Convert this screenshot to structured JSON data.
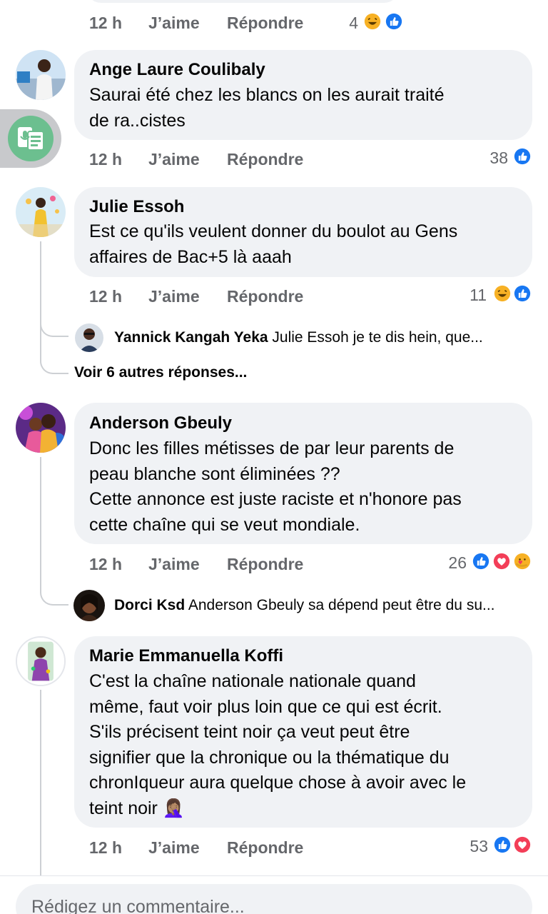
{
  "comments": [
    {
      "time": "12 h",
      "like": "J’aime",
      "reply": "Répondre",
      "count": "4",
      "reactions": [
        "haha-reaction",
        "like-reaction"
      ]
    },
    {
      "author": "Ange Laure Coulibaly",
      "lines": [
        "Saurai été chez les blancs on les aurait traité",
        "de ra..cistes"
      ],
      "time": "12 h",
      "like": "J’aime",
      "reply": "Répondre",
      "count": "38",
      "reactions": [
        "like-reaction"
      ]
    },
    {
      "author": "Julie Essoh",
      "lines": [
        "Est ce qu'ils veulent donner du boulot au Gens",
        "affaires de Bac+5 là aaah"
      ],
      "time": "12 h",
      "like": "J’aime",
      "reply": "Répondre",
      "count": "11",
      "reactions": [
        "haha-reaction",
        "like-reaction"
      ],
      "reply_preview": {
        "name": "Yannick Kangah Yeka",
        "text": "Julie Essoh je te dis hein,   que..."
      },
      "more_replies": "Voir 6 autres réponses..."
    },
    {
      "author": "Anderson Gbeuly",
      "lines": [
        "Donc les filles métisses de par leur parents de",
        "peau blanche sont éliminées ??",
        "Cette annonce est juste raciste et n'honore pas",
        "cette chaîne qui se veut mondiale."
      ],
      "time": "12 h",
      "like": "J’aime",
      "reply": "Répondre",
      "count": "26",
      "reactions": [
        "like-reaction",
        "love-reaction",
        "care-reaction"
      ],
      "reply_preview": {
        "name": "Dorci Ksd",
        "text": "Anderson Gbeuly sa dépend peut être du su..."
      }
    },
    {
      "author": "Marie Emmanuella Koffi",
      "lines": [
        "C'est la chaîne nationale nationale quand",
        "même, faut voir plus loin que ce qui est écrit.",
        "S'ils précisent teint noir ça veut peut être",
        "signifier que la chronique ou la thématique du",
        "chronIqueur aura quelque chose à avoir avec le",
        "teint noir 🤦🏽‍♀️"
      ],
      "time": "12 h",
      "like": "J’aime",
      "reply": "Répondre",
      "count": "53",
      "reactions": [
        "like-reaction",
        "love-reaction"
      ]
    }
  ],
  "composer": {
    "placeholder": "Rédigez un commentaire..."
  },
  "colors": {
    "meta": "#65676b",
    "bubble": "#f0f2f5",
    "like": "#1877f2",
    "love": "#f33e58",
    "haha": "#f7b125"
  },
  "floating_button_icon": "voice-document-icon"
}
